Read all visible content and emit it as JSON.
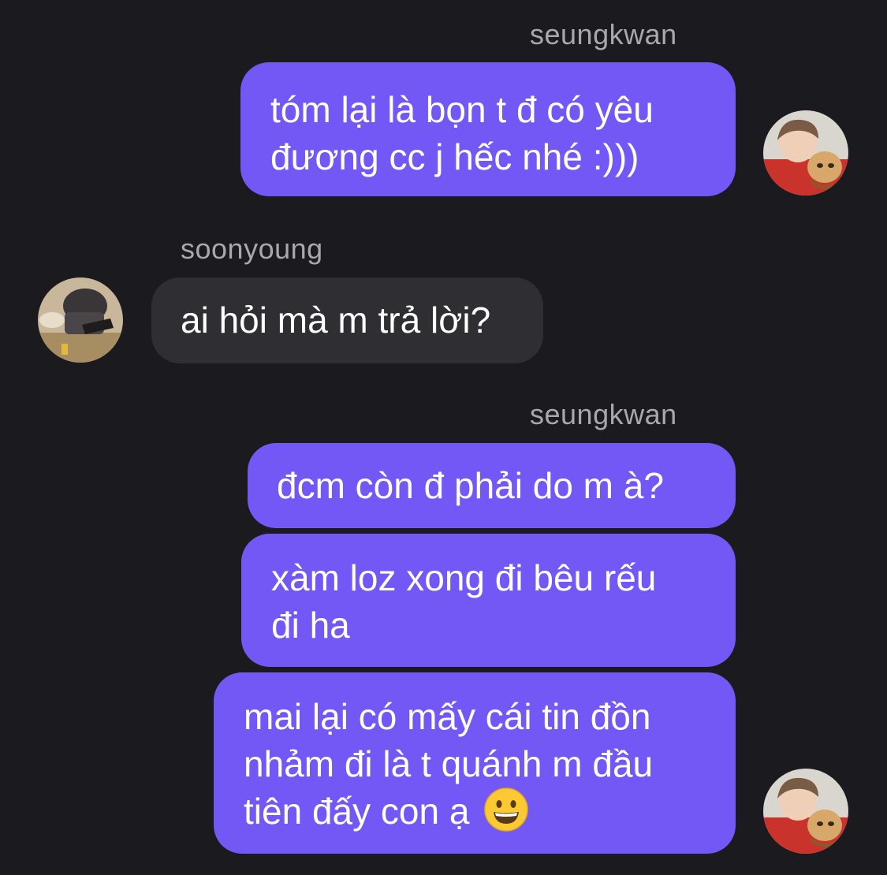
{
  "messages": [
    {
      "sender": "seungkwan",
      "direction": "outgoing",
      "lines": [
        "tóm lại là bọn t đ có yêu",
        "đương cc j hếc nhé :)))"
      ]
    },
    {
      "sender": "soonyoung",
      "direction": "incoming",
      "lines": [
        "ai hỏi mà m trả lời?"
      ]
    },
    {
      "sender": "seungkwan",
      "direction": "outgoing",
      "lines": [
        "đcm còn đ phải do m à?"
      ]
    },
    {
      "sender": "",
      "direction": "outgoing",
      "lines": [
        "xàm loz xong đi bêu rếu",
        "đi ha"
      ]
    },
    {
      "sender": "",
      "direction": "outgoing",
      "lines": [
        "mai lại có mấy cái tin đồn",
        "nhảm đi là t quánh m đầu",
        "tiên đấy con ạ"
      ],
      "trailing_emoji": "grinning-face-emoji"
    }
  ],
  "colors": {
    "background": "#1b1a1f",
    "outgoing_bubble": "#7458f5",
    "incoming_bubble": "#2f2e33",
    "sender_name": "#a9a8ae",
    "text": "#ffffff"
  },
  "icons": {
    "seungkwan_avatar": "avatar-photo-icon",
    "soonyoung_avatar": "avatar-photo-icon"
  }
}
